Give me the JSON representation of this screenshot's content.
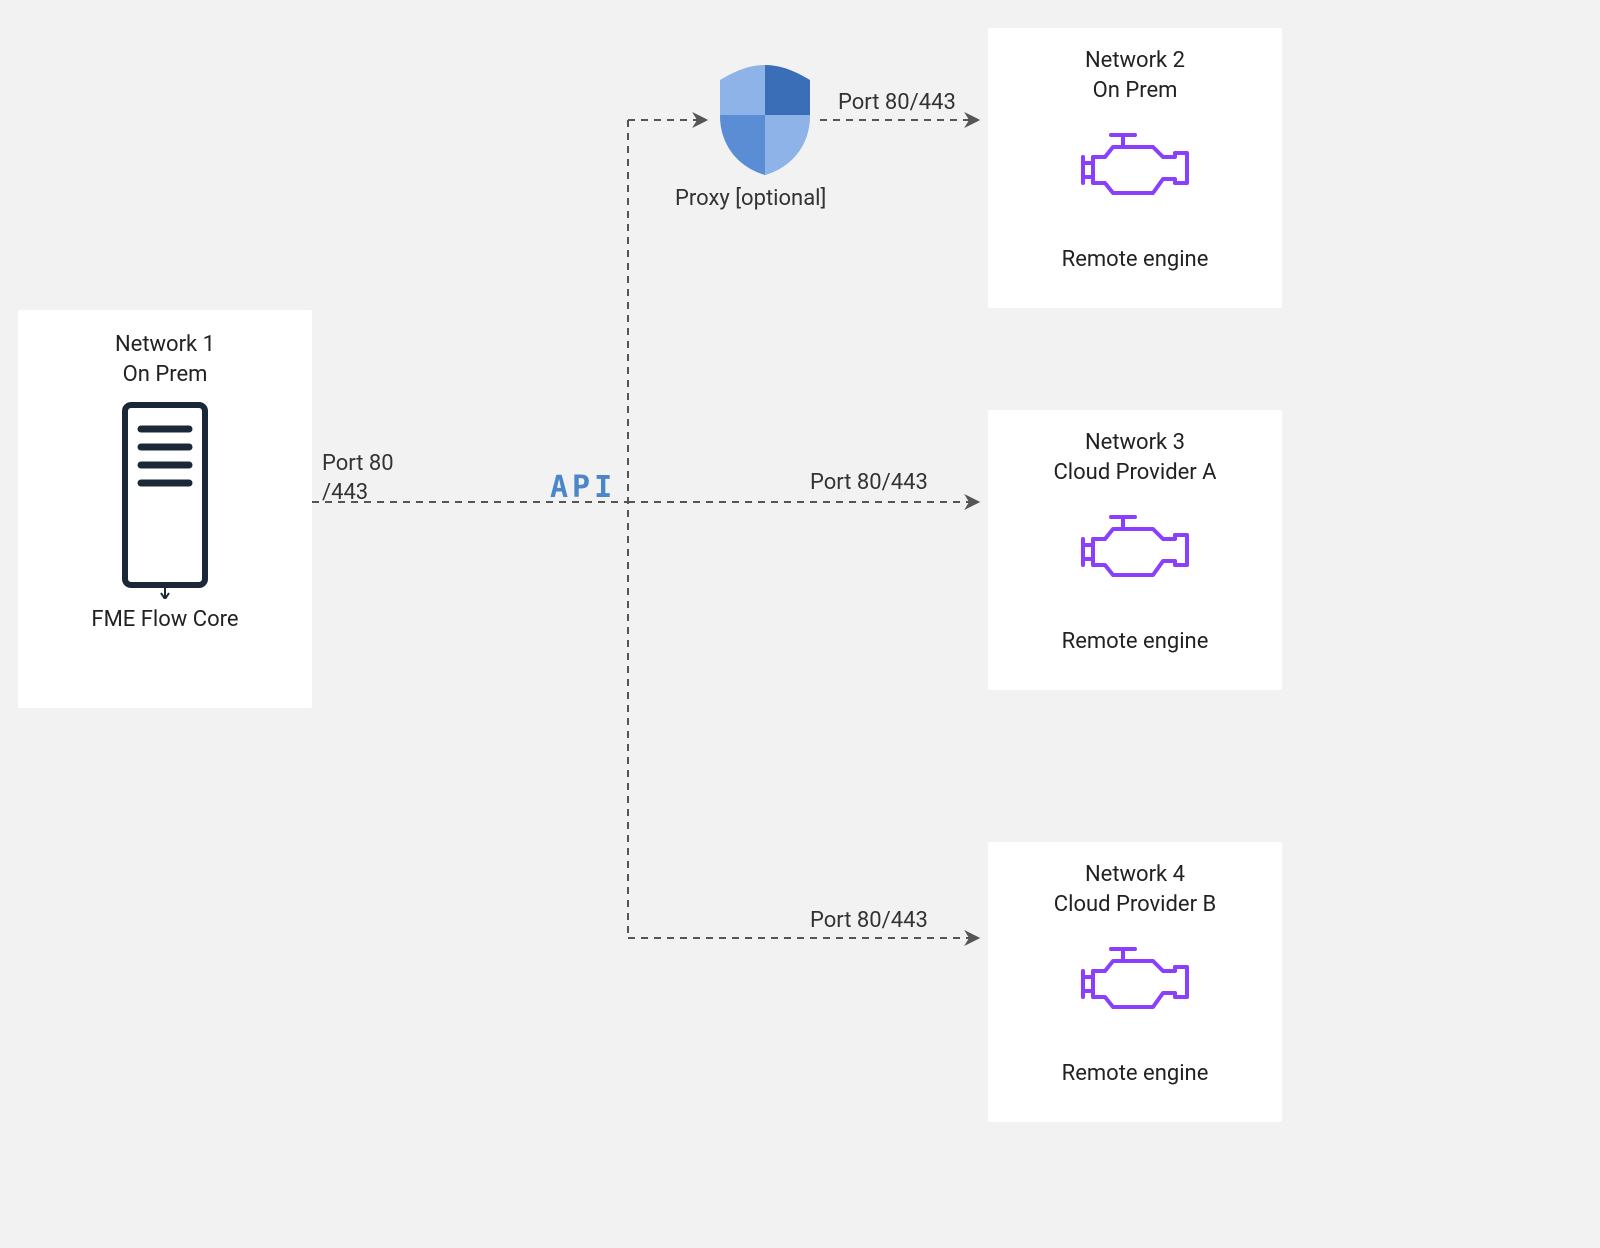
{
  "diagram": {
    "source": {
      "title_line1": "Network 1",
      "title_line2": "On Prem",
      "footer": "FME Flow Core",
      "icon": "server"
    },
    "api_label": "API",
    "main_connector_label_line1": "Port 80",
    "main_connector_label_line2": "/443",
    "proxy": {
      "label": "Proxy [optional]",
      "icon": "shield"
    },
    "branches": [
      {
        "id": "net2",
        "title_line1": "Network 2",
        "title_line2": "On Prem",
        "footer": "Remote engine",
        "port_label": "Port 80/443",
        "icon": "engine"
      },
      {
        "id": "net3",
        "title_line1": "Network 3",
        "title_line2": "Cloud Provider A",
        "footer": "Remote engine",
        "port_label": "Port 80/443",
        "icon": "engine"
      },
      {
        "id": "net4",
        "title_line1": "Network 4",
        "title_line2": "Cloud Provider B",
        "footer": "Remote engine",
        "port_label": "Port 80/443",
        "icon": "engine"
      }
    ]
  },
  "colors": {
    "line": "#555",
    "engine": "#8a3ffc",
    "server": "#1b2838",
    "shield_light": "#8db3e8",
    "shield_dark": "#3a6fb7",
    "shield_mid": "#5b8dd4"
  }
}
